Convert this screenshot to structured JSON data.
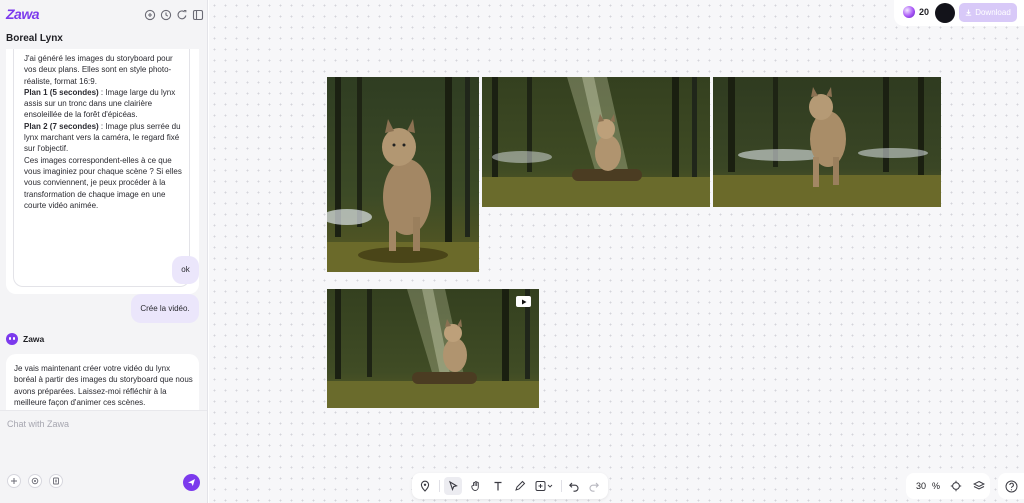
{
  "app": {
    "logo": "Zawa",
    "project_title": "Boreal Lynx"
  },
  "chat": {
    "assistant_intro": "J'ai généré les images du storyboard pour vos deux plans. Elles sont en style photo-réaliste, format 16:9.",
    "plan1_label": "Plan 1 (5 secondes)",
    "plan1_text": " : Image large du lynx assis sur un tronc dans une clairière ensoleillée de la forêt d'épicéas.",
    "plan2_label": "Plan 2 (7 secondes)",
    "plan2_text": " : Image plus serrée du lynx marchant vers la caméra, le regard fixé sur l'objectif.",
    "closing": "Ces images correspondent-elles à ce que vous imaginiez pour chaque scène ? Si elles vous conviennent, je peux procéder à la transformation de chaque image en une courte vidéo animée.",
    "user_msg_1": "ok",
    "user_msg_2": "Crée la vidéo.",
    "assistant_name": "Zawa",
    "assistant_reply": "Je vais maintenant créer votre vidéo du lynx boréal à partir des images du storyboard que nous avons préparées. Laissez-moi réfléchir à la meilleure façon d'animer ces scènes.",
    "input_placeholder": "Chat with Zawa"
  },
  "header": {
    "credits": "20",
    "download_label": "Download"
  },
  "zoom": {
    "value": "30",
    "unit": "%"
  },
  "canvas_items": [
    {
      "kind": "image",
      "subject": "lynx standing portrait"
    },
    {
      "kind": "image",
      "subject": "lynx sitting in sunbeam"
    },
    {
      "kind": "image",
      "subject": "lynx walking toward camera"
    },
    {
      "kind": "video",
      "subject": "lynx sitting on log, sun rays"
    }
  ],
  "icons": {
    "header": [
      "new-chat-icon",
      "history-icon",
      "refresh-icon",
      "sidebar-toggle-icon"
    ],
    "composer": [
      "plus-icon",
      "style-icon",
      "attachment-icon",
      "send-icon"
    ],
    "toolbar": [
      "location-pin-icon",
      "cursor-icon",
      "hand-icon",
      "text-icon",
      "pen-icon",
      "add-frame-icon",
      "undo-icon",
      "redo-icon"
    ],
    "zoom": [
      "crosshair-icon",
      "layers-icon"
    ],
    "help": "question-icon"
  },
  "colors": {
    "accent": "#7c3aed",
    "download_bg": "#d8c9f8",
    "user_bubble": "#ebe6fb"
  }
}
